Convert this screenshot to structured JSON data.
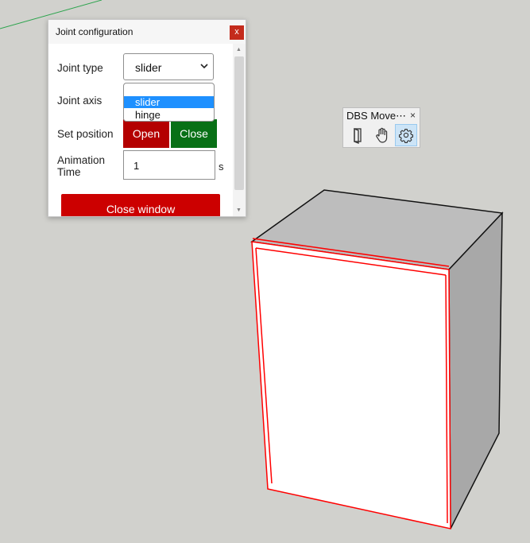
{
  "dialog": {
    "title": "Joint configuration",
    "close_glyph": "x",
    "joint_type_label": "Joint type",
    "joint_type_value": "slider",
    "joint_type_options": [
      "slider",
      "hinge"
    ],
    "joint_axis_label": "Joint axis",
    "set_position_label": "Set position",
    "open_label": "Open",
    "close_label": "Close",
    "animation_label_line1": "Animation",
    "animation_label_line2": "Time",
    "animation_time_value": "1",
    "animation_time_unit": "s",
    "close_window_label": "Close window"
  },
  "toolbar": {
    "title": "DBS Move⋯",
    "close_glyph": "×",
    "tools": [
      "door-icon",
      "hand-icon",
      "gear-icon"
    ]
  },
  "colors": {
    "viewport_bg": "#d1d1cd",
    "open_button": "#b40000",
    "close_button": "#087016",
    "close_window_button": "#cc0000",
    "selected_edge": "#ff0000",
    "dropdown_highlight": "#1e90ff",
    "active_tool_bg": "#cce4f7"
  }
}
